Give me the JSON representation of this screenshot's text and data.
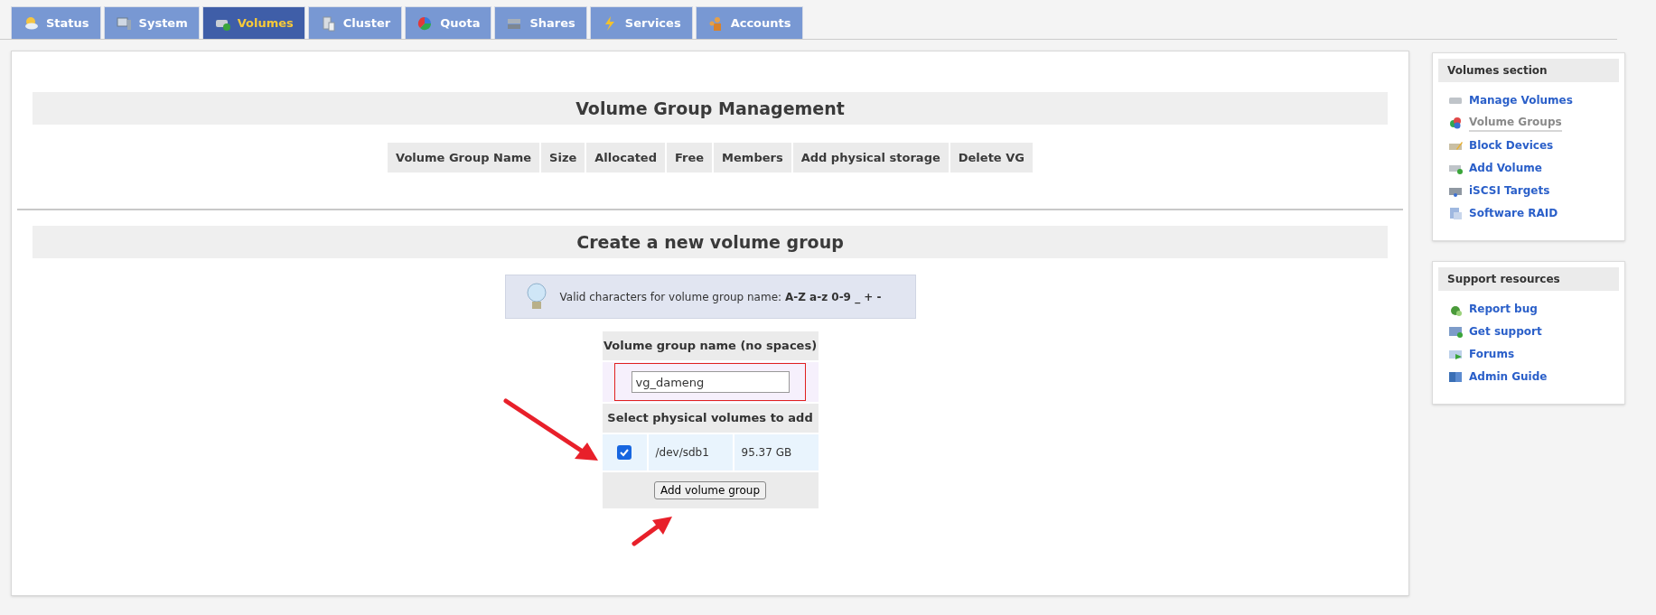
{
  "tabs": [
    {
      "label": "Status",
      "selected": false
    },
    {
      "label": "System",
      "selected": false
    },
    {
      "label": "Volumes",
      "selected": true
    },
    {
      "label": "Cluster",
      "selected": false
    },
    {
      "label": "Quota",
      "selected": false
    },
    {
      "label": "Shares",
      "selected": false
    },
    {
      "label": "Services",
      "selected": false
    },
    {
      "label": "Accounts",
      "selected": false
    }
  ],
  "management": {
    "title": "Volume Group Management",
    "columns": [
      "Volume Group Name",
      "Size",
      "Allocated",
      "Free",
      "Members",
      "Add physical storage",
      "Delete VG"
    ]
  },
  "create": {
    "title": "Create a new volume group",
    "hint": "Valid characters for volume group name: **A-Z a-z 0-9 _ + -**",
    "name_label": "Volume group name (no spaces)",
    "name_value": "vg_dameng",
    "select_label": "Select physical volumes to add",
    "volumes": [
      {
        "checked": true,
        "device": "/dev/sdb1",
        "size": "95.37 GB"
      }
    ],
    "submit": "Add volume group"
  },
  "sidebar": [
    {
      "title": "Volumes section",
      "items": [
        {
          "label": "Manage Volumes",
          "selected": false
        },
        {
          "label": "Volume Groups",
          "selected": true
        },
        {
          "label": "Block Devices",
          "selected": false
        },
        {
          "label": "Add Volume",
          "selected": false
        },
        {
          "label": "iSCSI Targets",
          "selected": false
        },
        {
          "label": "Software RAID",
          "selected": false
        }
      ]
    },
    {
      "title": "Support resources",
      "items": [
        {
          "label": "Report bug",
          "selected": false
        },
        {
          "label": "Get support",
          "selected": false
        },
        {
          "label": "Forums",
          "selected": false
        },
        {
          "label": "Admin Guide",
          "selected": false
        }
      ]
    }
  ]
}
